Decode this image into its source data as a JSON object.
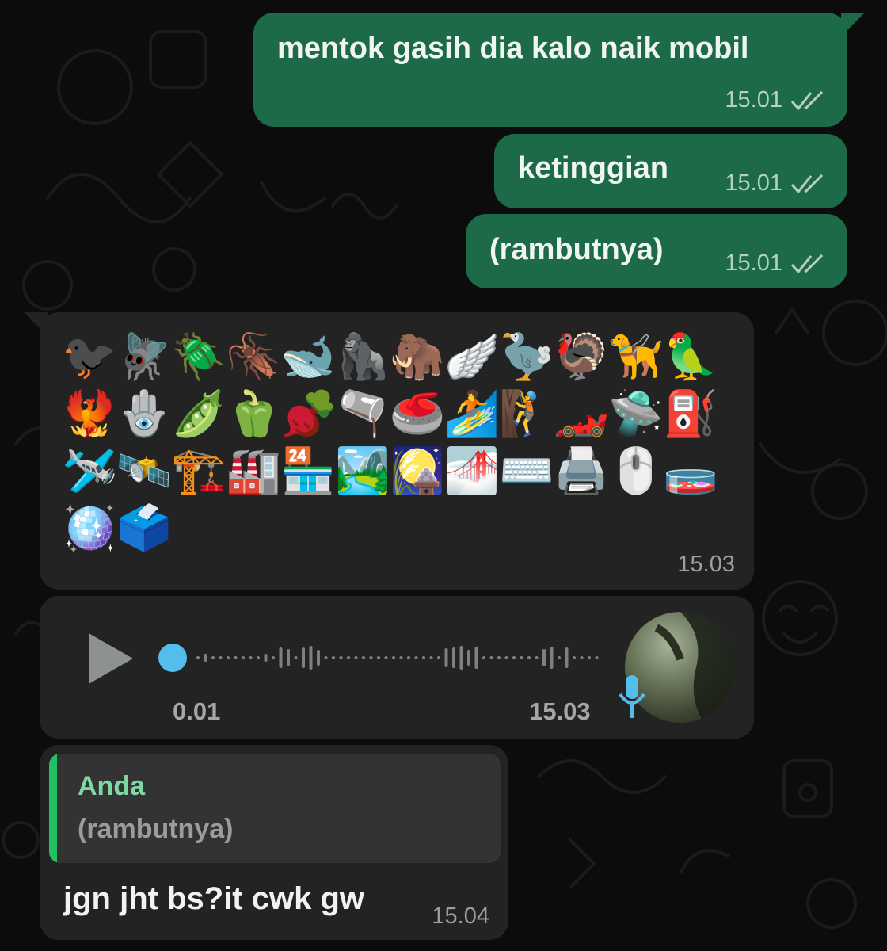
{
  "messages_outgoing": [
    {
      "text": "mentok gasih dia kalo naik mobil",
      "time": "15.01",
      "status": "read-double-check"
    },
    {
      "text": "ketinggian",
      "time": "15.01",
      "status": "read-double-check"
    },
    {
      "text": "(rambutnya)",
      "time": "15.01",
      "status": "read-double-check"
    }
  ],
  "emoji_message": {
    "emojis": [
      "🐦‍⬛",
      "🪰",
      "🪲",
      "🪳",
      "🐋",
      "🦍",
      "🦣",
      "🪽",
      "🦤",
      "🦃",
      "🦮",
      "🦜",
      "🐦‍🔥",
      "🪬",
      "🫛",
      "🫑",
      "🫜",
      "🫗",
      "🥌",
      "🏄",
      "🧗",
      "🏎️",
      "🛸",
      "⛽",
      "🛩️",
      "🛰️",
      "🏗️",
      "🏭",
      "🏪",
      "🏞️",
      "🎑",
      "🌁",
      "⌨️",
      "🖨️",
      "🖱️",
      "🧫",
      "🪩",
      "🗳️"
    ],
    "time": "15.03"
  },
  "voice_message": {
    "duration": "0.01",
    "time": "15.03",
    "progress": 0
  },
  "reply_message": {
    "quoted_author": "Anda",
    "quoted_text": "(rambutnya)",
    "text": "jgn jht bs?it cwk gw",
    "time": "15.04"
  },
  "colors": {
    "outgoing_bubble": "#1d6a48",
    "incoming_bubble": "#222322",
    "quote_accent": "#21c063",
    "voice_accent": "#53bdeb"
  }
}
